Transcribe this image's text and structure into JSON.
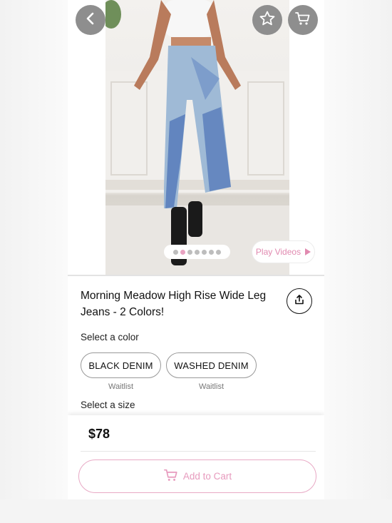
{
  "header": {
    "back_icon": "chevron-left-icon",
    "favorite_icon": "star-icon",
    "cart_icon": "cart-icon"
  },
  "gallery": {
    "image_count": 7,
    "active_index": 1,
    "play_videos_label": "Play Videos"
  },
  "product": {
    "title": "Morning Meadow High Rise Wide Leg Jeans - 2 Colors!",
    "share_icon": "share-icon"
  },
  "color_selector": {
    "label": "Select a color",
    "options": [
      {
        "name": "BLACK DENIM",
        "status": "Waitlist"
      },
      {
        "name": "WASHED DENIM",
        "status": "Waitlist"
      }
    ]
  },
  "size_selector": {
    "label": "Select a size"
  },
  "footer": {
    "price": "$78",
    "add_to_cart_label": "Add to Cart"
  },
  "colors": {
    "accent_pink": "#e79abd",
    "icon_button_bg": "#8e8e8e"
  }
}
